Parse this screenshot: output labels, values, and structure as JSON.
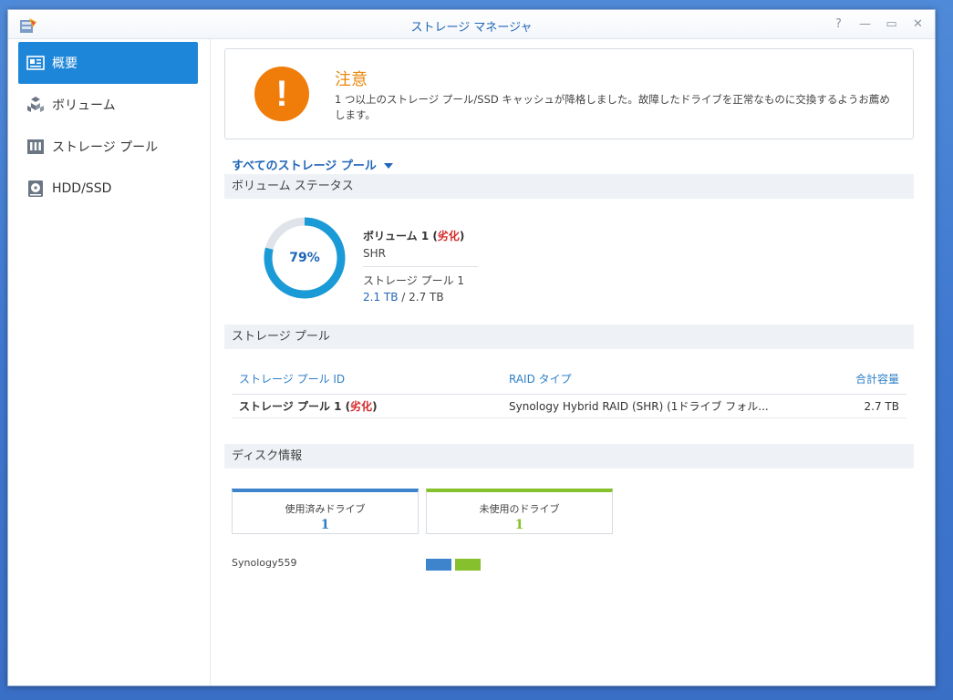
{
  "window": {
    "title": "ストレージ マネージャ",
    "controls": {
      "help": "?",
      "minimize": "—",
      "maximize": "▭",
      "close": "✕"
    }
  },
  "sidebar": {
    "items": [
      {
        "label": "概要",
        "icon": "overview-icon",
        "active": true
      },
      {
        "label": "ボリューム",
        "icon": "volume-icon"
      },
      {
        "label": "ストレージ プール",
        "icon": "storage-pool-icon"
      },
      {
        "label": "HDD/SSD",
        "icon": "hdd-icon"
      }
    ]
  },
  "alert": {
    "symbol": "!",
    "title": "注意",
    "message": "1 つ以上のストレージ プール/SSD キャッシュが降格しました。故障したドライブを正常なものに交換するようお薦めします。",
    "color": "#f07c0a"
  },
  "pool_selector": {
    "label": "すべてのストレージ プール"
  },
  "volume_status": {
    "heading": "ボリューム ステータス",
    "percent_label": "79%",
    "percent": 79,
    "name": "ボリューム 1 (",
    "status": "劣化",
    "name_close": ")",
    "raid_type": "SHR",
    "pool": "ストレージ プール 1",
    "used": "2.1 TB",
    "separator": " / ",
    "total": "2.7 TB"
  },
  "storage_pool": {
    "heading": "ストレージ プール",
    "columns": [
      "ストレージ プール ID",
      "RAID タイプ",
      "合計容量"
    ],
    "rows": [
      {
        "name": "ストレージ プール 1 (",
        "status": "劣化",
        "name_close": ")",
        "raid": "Synology Hybrid RAID (SHR) (1ドライブ フォル...",
        "capacity": "2.7 TB"
      }
    ]
  },
  "disk_info": {
    "heading": "ディスク情報",
    "used_label": "使用済みドライブ",
    "used_count": "1",
    "unused_label": "未使用のドライブ",
    "unused_count": "1",
    "host": "Synology559"
  },
  "colors": {
    "accent": "#1e86d9",
    "degraded": "#d42a2a",
    "used": "#3e84cc",
    "unused": "#86c02c"
  }
}
